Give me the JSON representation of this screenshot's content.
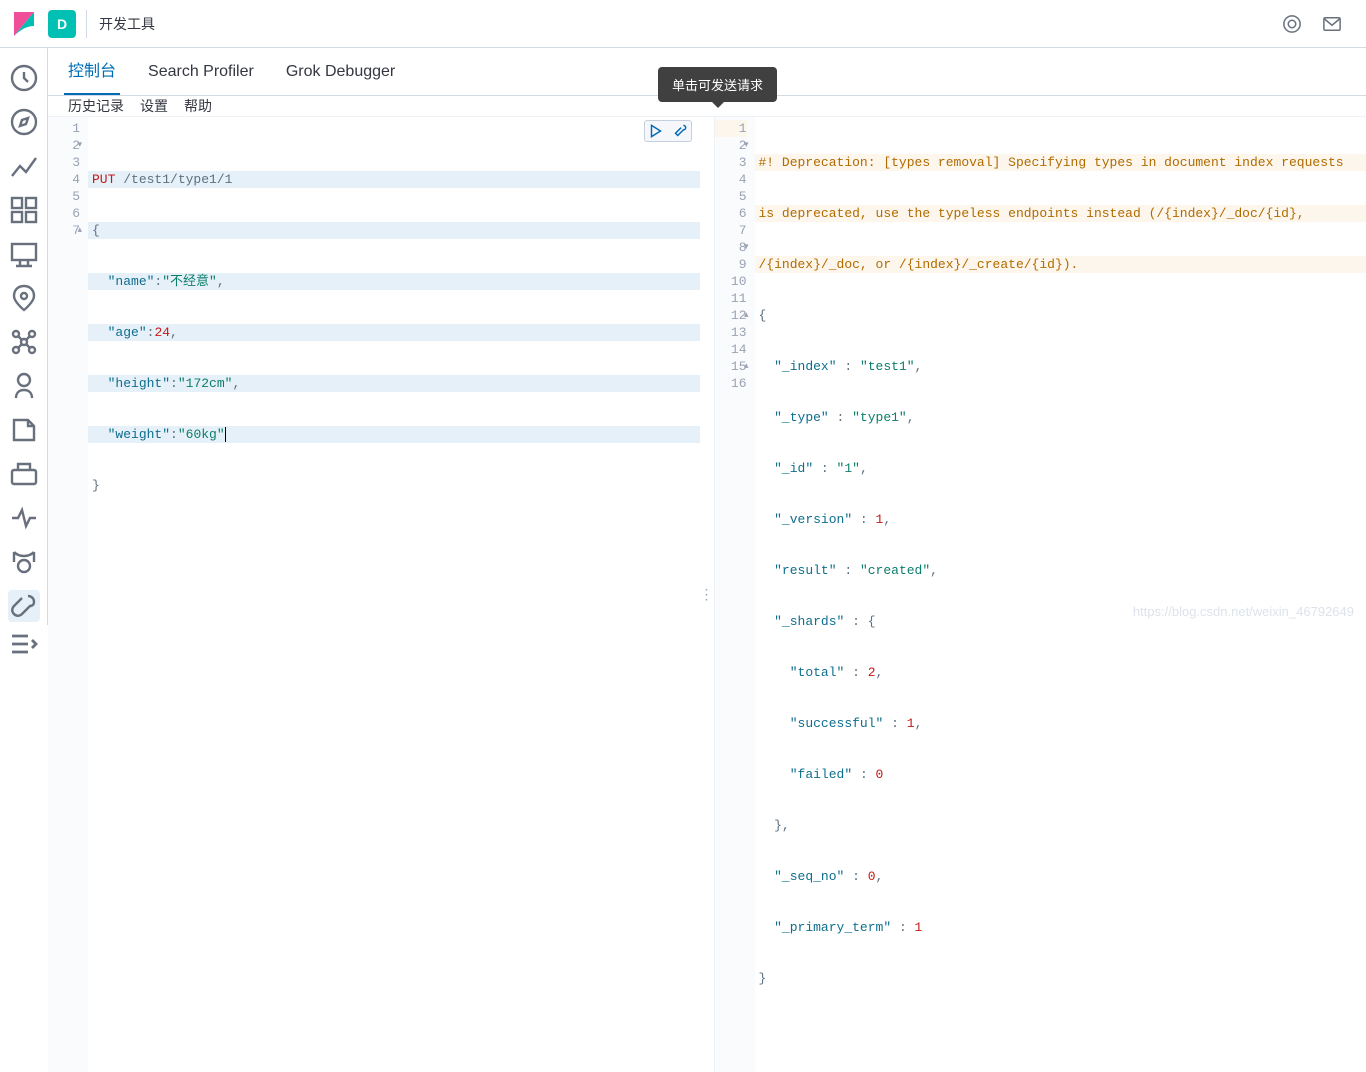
{
  "header": {
    "space_letter": "D",
    "breadcrumb": "开发工具"
  },
  "tabs": [
    {
      "label": "控制台",
      "active": true
    },
    {
      "label": "Search Profiler",
      "active": false
    },
    {
      "label": "Grok Debugger",
      "active": false
    }
  ],
  "toolbar": {
    "history": "历史记录",
    "settings": "设置",
    "help": "帮助"
  },
  "tooltip": "单击可发送请求",
  "request": {
    "lines": [
      "1",
      "2",
      "3",
      "4",
      "5",
      "6",
      "7"
    ],
    "method": "PUT",
    "path": "/test1/type1/1",
    "body_open": "{",
    "fields": [
      {
        "key": "\"name\"",
        "sep": ":",
        "val": "\"不经意\"",
        "tail": ","
      },
      {
        "key": "\"age\"",
        "sep": ":",
        "val": "24",
        "tail": ",",
        "num": true
      },
      {
        "key": "\"height\"",
        "sep": ":",
        "val": "\"172cm\"",
        "tail": ","
      },
      {
        "key": "\"weight\"",
        "sep": ":",
        "val": "\"60kg\"",
        "tail": ""
      }
    ],
    "body_close": "}"
  },
  "response": {
    "lines": [
      "1",
      "2",
      "3",
      "4",
      "5",
      "6",
      "7",
      "8",
      "9",
      "10",
      "11",
      "12",
      "13",
      "14",
      "15",
      "16"
    ],
    "warn1": "#! Deprecation: [types removal] Specifying types in document index requests",
    "warn2": "is deprecated, use the typeless endpoints instead (/{index}/_doc/{id},",
    "warn3": "/{index}/_doc, or /{index}/_create/{id}).",
    "rows": [
      {
        "t": "open",
        "txt": "{"
      },
      {
        "t": "kv",
        "k": "\"_index\"",
        "v": "\"test1\"",
        "tail": ","
      },
      {
        "t": "kv",
        "k": "\"_type\"",
        "v": "\"type1\"",
        "tail": ","
      },
      {
        "t": "kv",
        "k": "\"_id\"",
        "v": "\"1\"",
        "tail": ","
      },
      {
        "t": "kvn",
        "k": "\"_version\"",
        "v": "1",
        "tail": ","
      },
      {
        "t": "kv",
        "k": "\"result\"",
        "v": "\"created\"",
        "tail": ","
      },
      {
        "t": "ko",
        "k": "\"_shards\"",
        "v": "{"
      },
      {
        "t": "kvn2",
        "k": "\"total\"",
        "v": "2",
        "tail": ","
      },
      {
        "t": "kvn2",
        "k": "\"successful\"",
        "v": "1",
        "tail": ","
      },
      {
        "t": "kvn2",
        "k": "\"failed\"",
        "v": "0",
        "tail": ""
      },
      {
        "t": "close1",
        "txt": "},"
      },
      {
        "t": "kvn",
        "k": "\"_seq_no\"",
        "v": "0",
        "tail": ","
      },
      {
        "t": "kvn",
        "k": "\"_primary_term\"",
        "v": "1",
        "tail": ""
      },
      {
        "t": "close",
        "txt": "}"
      }
    ]
  },
  "watermark": "https://blog.csdn.net/weixin_46792649"
}
